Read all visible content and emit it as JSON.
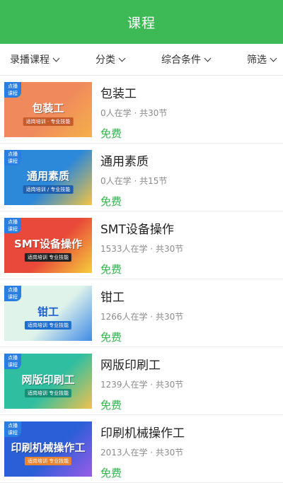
{
  "header": {
    "title": "课程"
  },
  "filters": [
    {
      "label": "录播课程"
    },
    {
      "label": "分类"
    },
    {
      "label": "综合条件"
    },
    {
      "label": "筛选"
    }
  ],
  "badge_text": "点播\n课程",
  "courses": [
    {
      "title": "包装工",
      "meta": "0人在学 · 共30节",
      "price": "免费",
      "banner": "包装工",
      "tag": "适岗培训 · 专业技能",
      "bg": "#f08a5d",
      "bg2": "#f5b04a",
      "tagbg": "#c55a2b"
    },
    {
      "title": "通用素质",
      "meta": "0人在学 · 共15节",
      "price": "免费",
      "banner": "通用素质",
      "tag": "适岗培训 / 专业技能",
      "bg": "#2c88d9",
      "bg2": "#f4c542",
      "tagbg": "#1f5fae"
    },
    {
      "title": "SMT设备操作",
      "meta": "1533人在学 · 共30节",
      "price": "免费",
      "banner": "SMT设备操作",
      "tag": "适岗培训 专业技能",
      "bg": "#e9493a",
      "bg2": "#f5cf3b",
      "tagbg": "#222"
    },
    {
      "title": "钳工",
      "meta": "1266人在学 · 共30节",
      "price": "免费",
      "banner": "钳工",
      "tag": "适岗培训 专业技能",
      "bg": "#dff3ea",
      "bg2": "#3f8be6",
      "tagbg": "#1e6fd0"
    },
    {
      "title": "网版印刷工",
      "meta": "1239人在学 · 共30节",
      "price": "免费",
      "banner": "网版印刷工",
      "tag": "适岗培训 专业技能",
      "bg": "#2fbfa0",
      "bg2": "#f2c14e",
      "tagbg": "#168f76"
    },
    {
      "title": "印刷机械操作工",
      "meta": "2013人在学 · 共30节",
      "price": "免费",
      "banner": "印刷机械操作工",
      "tag": "适岗培训 专业技能",
      "bg": "#2a5fd8",
      "bg2": "#9a5ce8",
      "tagbg": "#e8832f"
    }
  ]
}
